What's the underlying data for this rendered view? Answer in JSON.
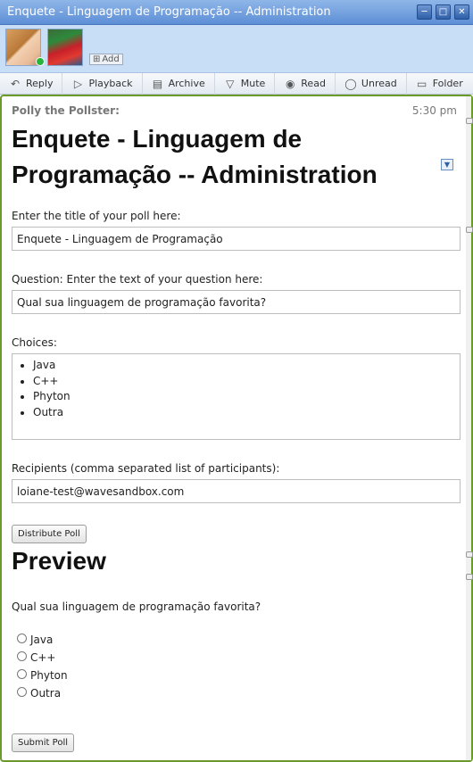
{
  "window": {
    "title": "Enquete - Linguagem de Programação -- Administration",
    "controls": [
      "minimize-icon",
      "restore-icon",
      "close-icon"
    ]
  },
  "participants": {
    "add_label": "Add"
  },
  "toolbar": {
    "items": [
      {
        "label": "Reply",
        "icon": "reply-icon"
      },
      {
        "label": "Playback",
        "icon": "playback-icon"
      },
      {
        "label": "Archive",
        "icon": "archive-icon"
      },
      {
        "label": "Mute",
        "icon": "mute-icon"
      },
      {
        "label": "Read",
        "icon": "read-icon"
      },
      {
        "label": "Unread",
        "icon": "unread-icon"
      },
      {
        "label": "Folder",
        "icon": "folder-icon"
      }
    ]
  },
  "blip": {
    "author": "Polly the Pollster:",
    "time": "5:30 pm",
    "heading": "Enquete - Linguagem  de Programação -- Administration"
  },
  "form": {
    "title_label": "Enter the title of your poll here:",
    "title_value": "Enquete - Linguagem  de Programação",
    "question_label": "Question: Enter the text of your question here:",
    "question_value": "Qual sua linguagem de programação favorita?",
    "choices_label": "Choices:",
    "choices": [
      "Java",
      "C++",
      "Phyton",
      "Outra"
    ],
    "recipients_label": "Recipients (comma separated list of participants):",
    "recipients_value": "loiane-test@wavesandbox.com",
    "distribute_label": "Distribute Poll"
  },
  "preview": {
    "title": "Preview",
    "question": "Qual sua linguagem de programação favorita?",
    "options": [
      "Java",
      "C++",
      "Phyton",
      "Outra"
    ],
    "submit_label": "Submit Poll"
  },
  "colors": {
    "titlebar": "#5d8fd6",
    "participants_bg": "#c8def6",
    "wave_border": "#6a9a2a",
    "online": "#26b43a"
  }
}
